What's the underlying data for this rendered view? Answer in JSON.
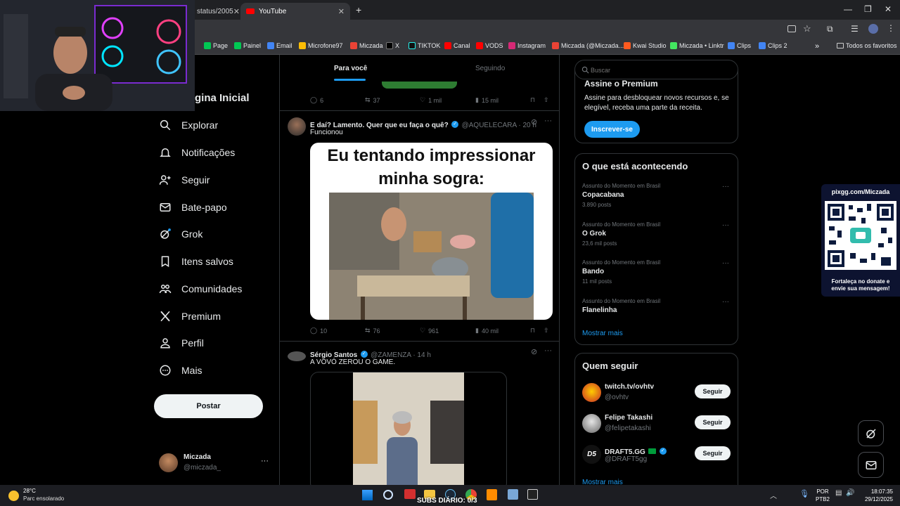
{
  "browser": {
    "tabs": [
      {
        "label": "status/2005"
      },
      {
        "label": "YouTube"
      }
    ],
    "new_tab": "+",
    "bookmarks": [
      {
        "label": "Page",
        "color": "#00c853"
      },
      {
        "label": "Painel",
        "color": "#00c853"
      },
      {
        "label": "Email",
        "color": "#4285f4"
      },
      {
        "label": "Microfone97",
        "color": "#fbbc05"
      },
      {
        "label": "Miczada",
        "color": "#ea4335"
      },
      {
        "label": "X",
        "color": "#000000"
      },
      {
        "label": "TIKTOK",
        "color": "#111111"
      },
      {
        "label": "Canal",
        "color": "#ff0000"
      },
      {
        "label": "VODS",
        "color": "#ff0000"
      },
      {
        "label": "Instagram",
        "color": "#d62976"
      },
      {
        "label": "Miczada (@Miczada...",
        "color": "#ea4335"
      },
      {
        "label": "Kwai Studio",
        "color": "#ff5a1f"
      },
      {
        "label": "Miczada • Linktr",
        "color": "#43e660"
      },
      {
        "label": "Clips",
        "color": "#4285f4"
      },
      {
        "label": "Clips 2",
        "color": "#4285f4"
      }
    ],
    "more_bookmarks": "»",
    "all_favorites": "Todos os favoritos"
  },
  "sidebar": {
    "home_label": "gina Inicial",
    "items": [
      {
        "label": "Explorar",
        "icon": "search-icon"
      },
      {
        "label": "Notificações",
        "icon": "bell-icon"
      },
      {
        "label": "Seguir",
        "icon": "user-plus-icon"
      },
      {
        "label": "Bate-papo",
        "icon": "mail-icon"
      },
      {
        "label": "Grok",
        "icon": "grok-icon"
      },
      {
        "label": "Itens salvos",
        "icon": "bookmark-icon"
      },
      {
        "label": "Comunidades",
        "icon": "people-icon"
      },
      {
        "label": "Premium",
        "icon": "x-logo-icon"
      },
      {
        "label": "Perfil",
        "icon": "person-icon"
      },
      {
        "label": "Mais",
        "icon": "more-circle-icon"
      }
    ],
    "post_button": "Postar",
    "account": {
      "name": "Miczada",
      "handle": "@miczada_",
      "more": "···"
    }
  },
  "feed": {
    "tabs": [
      {
        "label": "Para você"
      },
      {
        "label": "Seguindo"
      }
    ],
    "prev_post_actions": {
      "replies": "6",
      "reposts": "37",
      "likes": "1 mil",
      "views": "15 mil"
    },
    "posts": [
      {
        "author": "E daí? Lamento. Quer que eu faça o quê?",
        "handle": "@AQUELECARA · 20 h",
        "text": "Funcionou",
        "media_caption": "Eu tentando impressionar minha sogra:",
        "actions": {
          "replies": "10",
          "reposts": "76",
          "likes": "961",
          "views": "40 mil"
        }
      },
      {
        "author": "Sérgio Santos",
        "handle": "@ZAMENZA · 14 h",
        "text": "A VOVÓ ZEROU O GAME."
      }
    ]
  },
  "right": {
    "search_placeholder": "Buscar",
    "premium": {
      "title": "Assine o Premium",
      "desc": "Assine para desbloquear novos recursos e, se elegível, receba uma parte da receita.",
      "button": "Inscrever-se"
    },
    "trends_title": "O que está acontecendo",
    "trends": [
      {
        "context": "Assunto do Momento em Brasil",
        "name": "Copacabana",
        "count": "3.890 posts"
      },
      {
        "context": "Assunto do Momento em Brasil",
        "name": "O Grok",
        "count": "23,6 mil posts"
      },
      {
        "context": "Assunto do Momento em Brasil",
        "name": "Bando",
        "count": "11 mil posts"
      },
      {
        "context": "Assunto do Momento em Brasil",
        "name": "Flanelinha",
        "count": ""
      }
    ],
    "show_more": "Mostrar mais",
    "follow_title": "Quem seguir",
    "follow": [
      {
        "name": "twitch.tv/ovhtv",
        "handle": "@ovhtv",
        "button": "Seguir"
      },
      {
        "name": "Felipe Takashi",
        "handle": "@felipetakashi",
        "button": "Seguir"
      },
      {
        "name": "DRAFT5.GG",
        "handle": "@DRAFT5gg",
        "button": "Seguir",
        "avatar_text": "D5"
      }
    ],
    "follow_more": "Mostrar mais"
  },
  "overlay": {
    "pix_title": "pixgg.com/Miczada",
    "pix_caption": "Fortaleça no donate e envie sua mensagem!"
  },
  "taskbar": {
    "temp": "28°C",
    "weather": "Parc ensolarado",
    "subs": "SUBS DIÁRIO: 0/3",
    "lang": "POR",
    "layout": "PTB2",
    "time": "18:07:35",
    "date": "29/12/2025"
  }
}
